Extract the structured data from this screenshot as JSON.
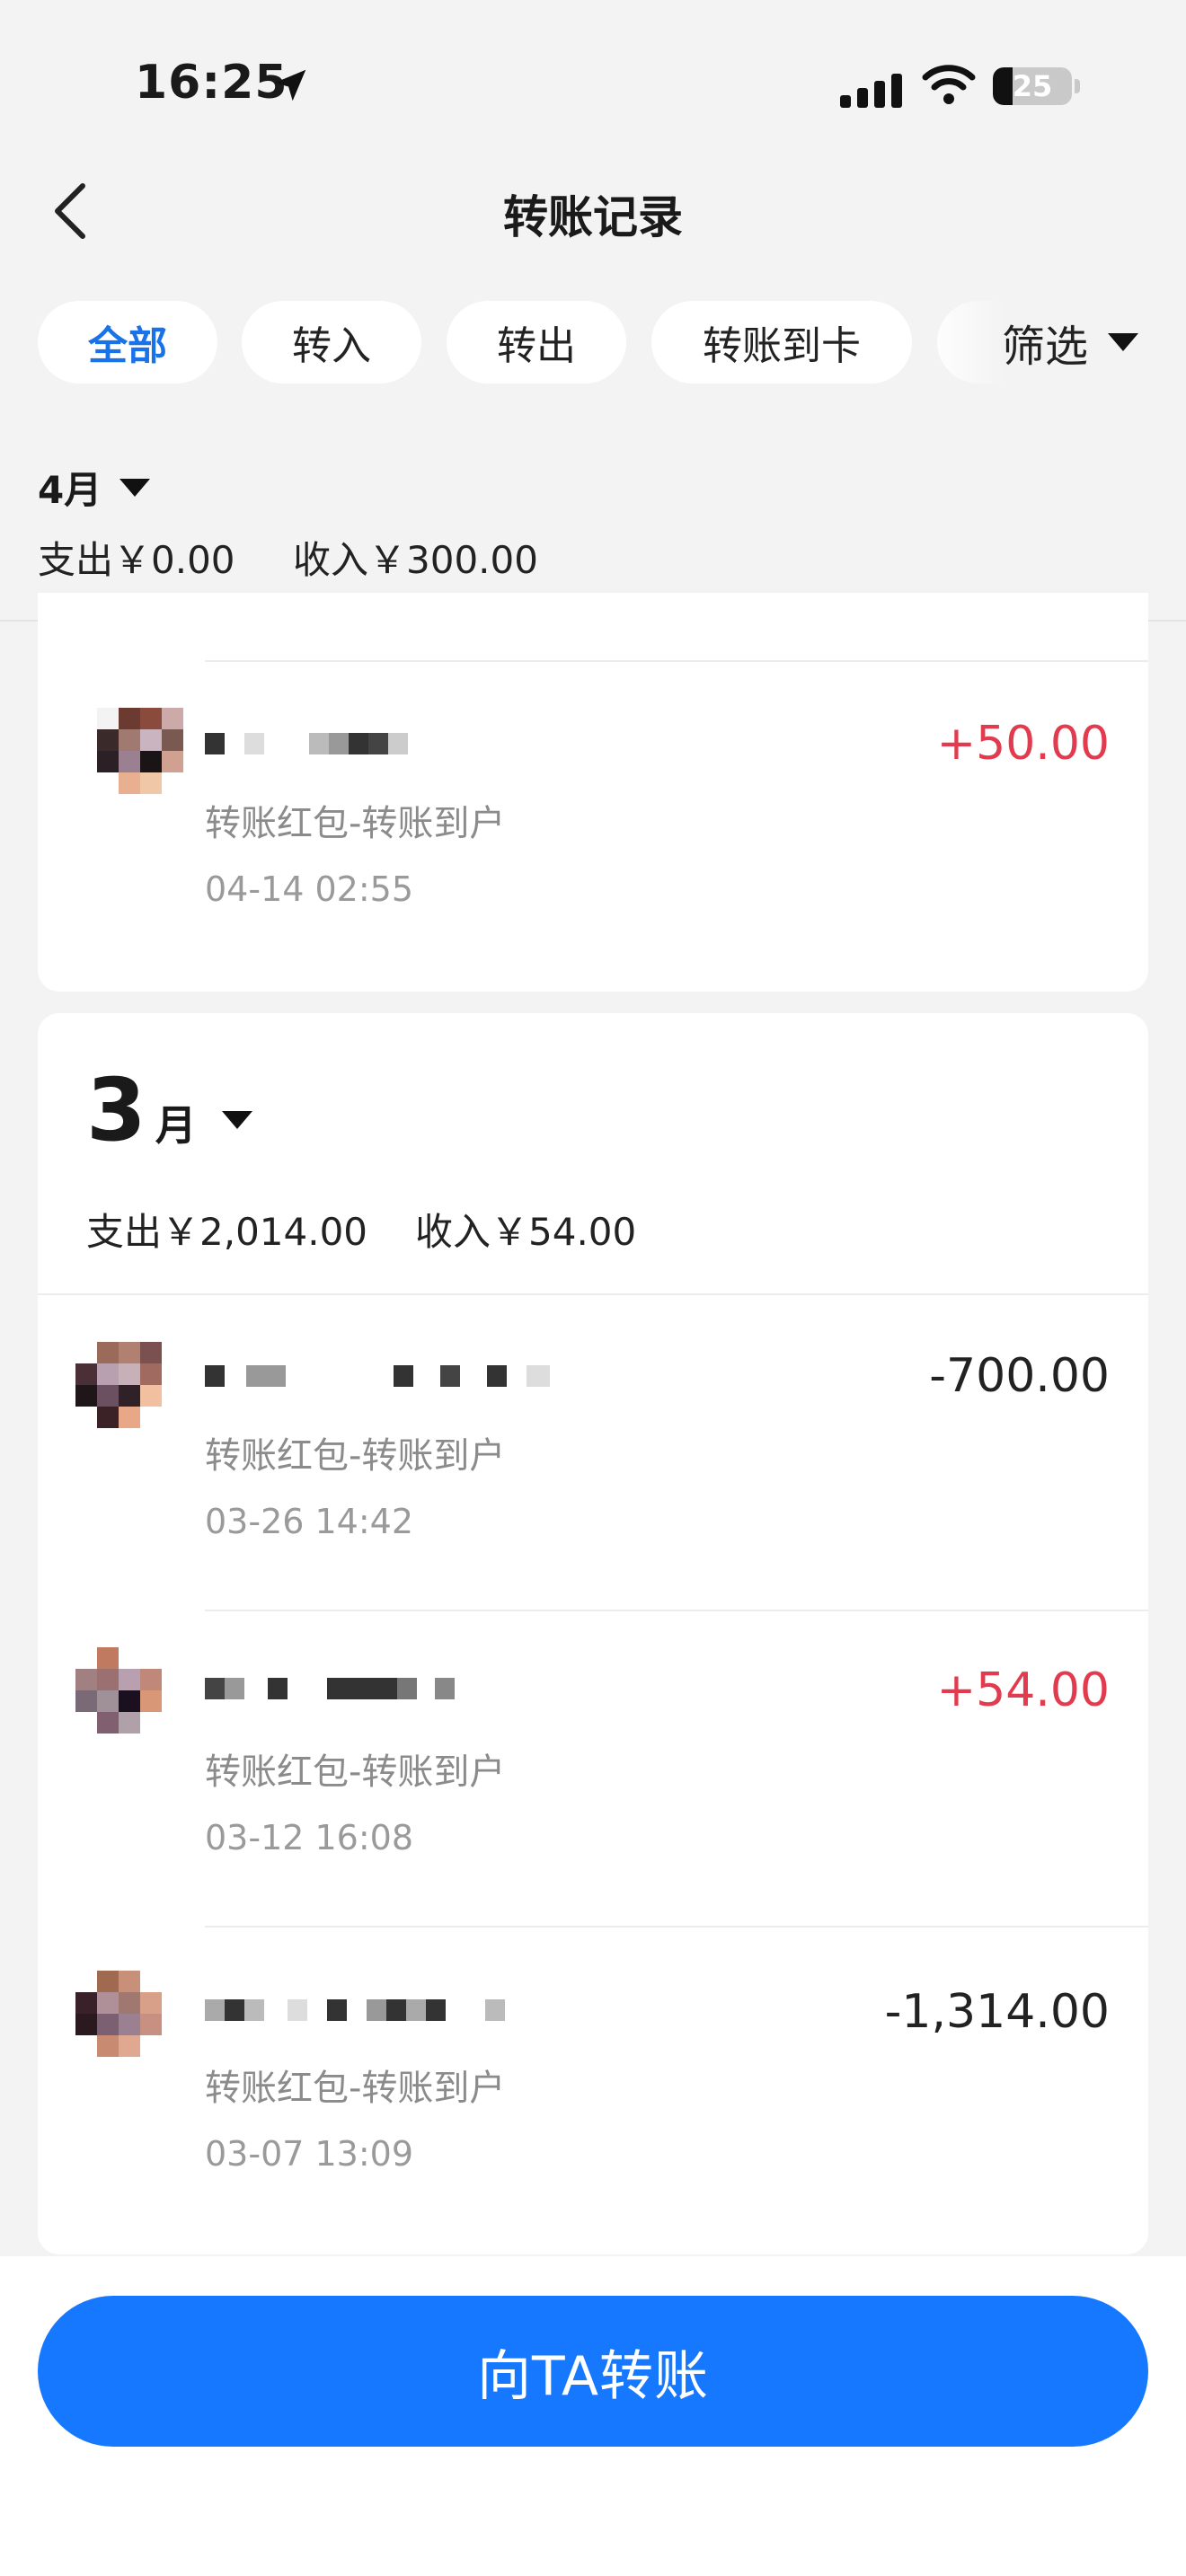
{
  "status_bar": {
    "time": "16:25",
    "battery": "25",
    "battery_level_percent": 25
  },
  "header": {
    "title": "转账记录"
  },
  "filters": {
    "chips": [
      {
        "label": "全部",
        "active": true
      },
      {
        "label": "转入",
        "active": false
      },
      {
        "label": "转出",
        "active": false
      },
      {
        "label": "转账到卡",
        "active": false
      }
    ],
    "filter_label": "筛选"
  },
  "months": [
    {
      "label": "4月",
      "expense": "支出￥0.00",
      "income": "收入￥300.00",
      "transactions": [
        {
          "desc": "转账红包-转账到户",
          "time": "04-14 02:55",
          "amount": "+50.00",
          "direction": "in"
        }
      ]
    },
    {
      "label_num": "3",
      "label_unit": "月",
      "expense": "支出￥2,014.00",
      "income": "收入￥54.00",
      "transactions": [
        {
          "desc": "转账红包-转账到户",
          "time": "03-26 14:42",
          "amount": "-700.00",
          "direction": "out"
        },
        {
          "desc": "转账红包-转账到户",
          "time": "03-12 16:08",
          "amount": "+54.00",
          "direction": "in"
        },
        {
          "desc": "转账红包-转账到户",
          "time": "03-07 13:09",
          "amount": "-1,314.00",
          "direction": "out"
        }
      ]
    }
  ],
  "bottom": {
    "button_label": "向TA转账"
  },
  "colors": {
    "accent": "#1677ff",
    "chip_active": "#1a72e8",
    "income": "#e23a4e",
    "expense": "#222222"
  },
  "icons": [
    "location-arrow-icon",
    "signal-icon",
    "wifi-icon",
    "battery-icon",
    "back-chevron-icon",
    "dropdown-triangle-icon"
  ]
}
